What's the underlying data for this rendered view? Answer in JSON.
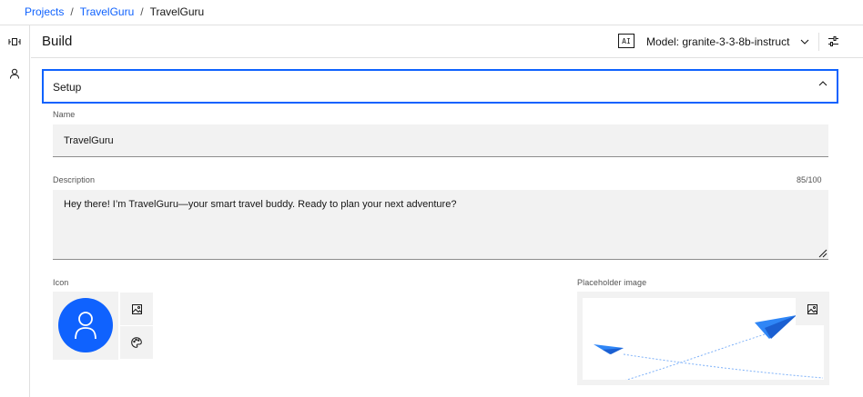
{
  "breadcrumb": {
    "items": [
      {
        "label": "Projects"
      },
      {
        "label": "TravelGuru"
      },
      {
        "label": "TravelGuru"
      }
    ],
    "separator": "/"
  },
  "header": {
    "title": "Build",
    "ai_badge": "AI",
    "model_label": "Model: granite-3-3-8b-instruct"
  },
  "setup": {
    "label": "Setup",
    "expanded": true
  },
  "form": {
    "name_label": "Name",
    "name_value": "TravelGuru",
    "description_label": "Description",
    "description_value": "Hey there! I’m TravelGuru—your smart travel buddy. Ready to plan your next adventure?",
    "description_count": "85/100",
    "icon_label": "Icon",
    "placeholder_label": "Placeholder image"
  },
  "icons": {
    "rail_top": "agent-icon",
    "rail_second": "user-icon",
    "settings": "sliders-icon",
    "upload": "image-icon",
    "palette": "palette-icon"
  },
  "colors": {
    "accent": "#0f62fe",
    "field_bg": "#f2f2f2",
    "avatar": "#0f62fe",
    "plane": "#2f86f6"
  }
}
